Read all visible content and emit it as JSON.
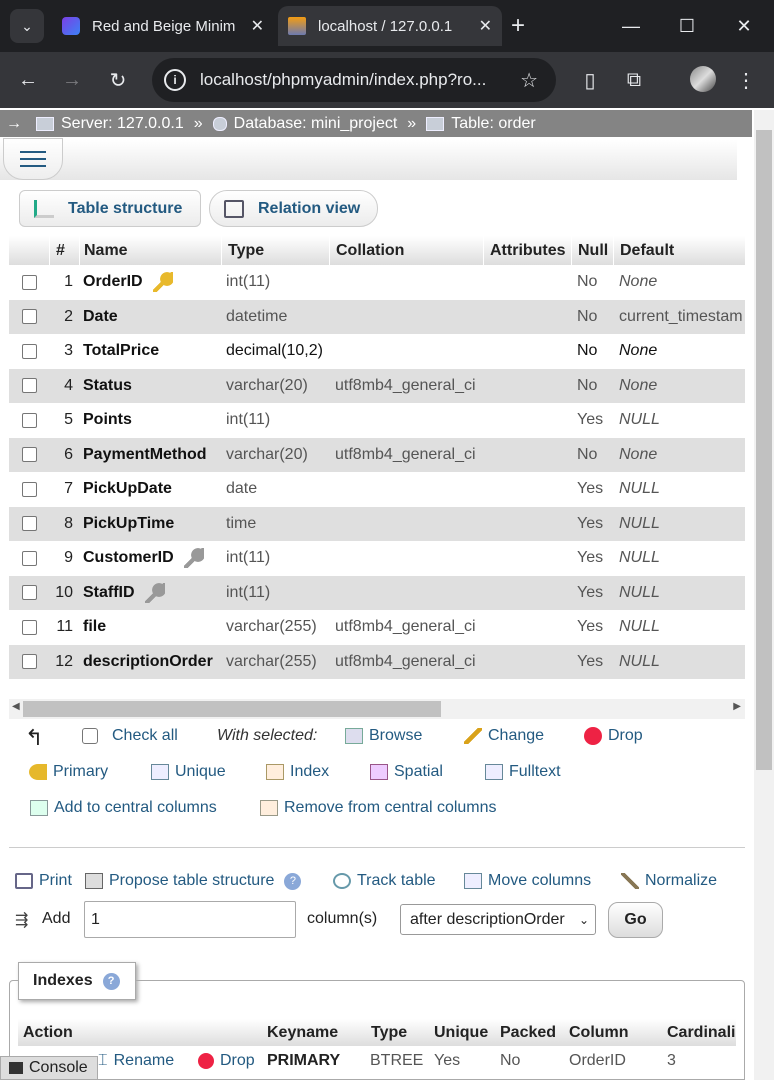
{
  "browser": {
    "tabs": [
      {
        "title": "Red and Beige Minim",
        "close": "✕"
      },
      {
        "title": "localhost / 127.0.0.1",
        "close": "✕"
      }
    ],
    "new_tab": "+",
    "url": "localhost/phpmyadmin/index.php?ro...",
    "window": {
      "minimize": "—",
      "maximize": "☐",
      "close": "✕"
    }
  },
  "breadcrumb": {
    "arrow": "→",
    "server": "Server: 127.0.0.1",
    "database": "Database: mini_project",
    "table": "Table: order",
    "sep": "»"
  },
  "subtabs": {
    "structure": "Table structure",
    "relation": "Relation view"
  },
  "columns_table": {
    "headers": [
      "#",
      "Name",
      "Type",
      "Collation",
      "Attributes",
      "Null",
      "Default"
    ],
    "rows": [
      {
        "num": "1",
        "name": "OrderID",
        "key": "primary",
        "type": "int(11)",
        "collation": "",
        "null": "No",
        "default": "None"
      },
      {
        "num": "2",
        "name": "Date",
        "key": "",
        "type": "datetime",
        "collation": "",
        "null": "No",
        "default": "current_timestam"
      },
      {
        "num": "3",
        "name": "TotalPrice",
        "key": "",
        "type": "decimal(10,2)",
        "collation": "",
        "null": "No",
        "default": "None"
      },
      {
        "num": "4",
        "name": "Status",
        "key": "",
        "type": "varchar(20)",
        "collation": "utf8mb4_general_ci",
        "null": "No",
        "default": "None"
      },
      {
        "num": "5",
        "name": "Points",
        "key": "",
        "type": "int(11)",
        "collation": "",
        "null": "Yes",
        "default": "NULL"
      },
      {
        "num": "6",
        "name": "PaymentMethod",
        "key": "",
        "type": "varchar(20)",
        "collation": "utf8mb4_general_ci",
        "null": "No",
        "default": "None"
      },
      {
        "num": "7",
        "name": "PickUpDate",
        "key": "",
        "type": "date",
        "collation": "",
        "null": "Yes",
        "default": "NULL"
      },
      {
        "num": "8",
        "name": "PickUpTime",
        "key": "",
        "type": "time",
        "collation": "",
        "null": "Yes",
        "default": "NULL"
      },
      {
        "num": "9",
        "name": "CustomerID",
        "key": "index",
        "type": "int(11)",
        "collation": "",
        "null": "Yes",
        "default": "NULL"
      },
      {
        "num": "10",
        "name": "StaffID",
        "key": "index",
        "type": "int(11)",
        "collation": "",
        "null": "Yes",
        "default": "NULL"
      },
      {
        "num": "11",
        "name": "file",
        "key": "",
        "type": "varchar(255)",
        "collation": "utf8mb4_general_ci",
        "null": "Yes",
        "default": "NULL"
      },
      {
        "num": "12",
        "name": "descriptionOrder",
        "key": "",
        "type": "varchar(255)",
        "collation": "utf8mb4_general_ci",
        "null": "Yes",
        "default": "NULL"
      }
    ]
  },
  "bulk": {
    "check_all": "Check all",
    "with_selected": "With selected:",
    "browse": "Browse",
    "change": "Change",
    "drop": "Drop",
    "primary": "Primary",
    "unique": "Unique",
    "index": "Index",
    "spatial": "Spatial",
    "fulltext": "Fulltext",
    "add_central": "Add to central columns",
    "remove_central": "Remove from central columns"
  },
  "actions": {
    "print": "Print",
    "propose": "Propose table structure",
    "track": "Track table",
    "move": "Move columns",
    "normalize": "Normalize"
  },
  "add_columns": {
    "label": "Add",
    "value": "1",
    "suffix": "column(s)",
    "position": "after descriptionOrder",
    "go": "Go"
  },
  "indexes": {
    "legend": "Indexes",
    "headers": [
      "Action",
      "Keyname",
      "Type",
      "Unique",
      "Packed",
      "Column",
      "Cardinali"
    ],
    "row": {
      "rename": "Rename",
      "drop": "Drop",
      "keyname": "PRIMARY",
      "type": "BTREE",
      "unique": "Yes",
      "packed": "No",
      "column": "OrderID",
      "cardinality": "3"
    }
  },
  "console": "Console"
}
